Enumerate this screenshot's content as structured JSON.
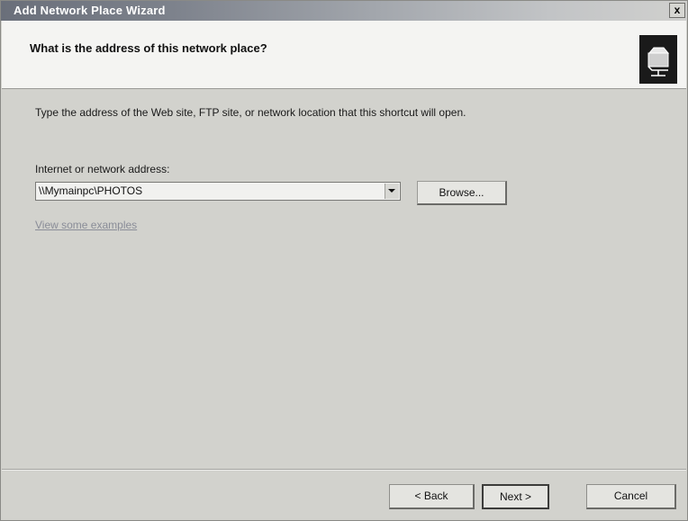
{
  "window": {
    "title": "Add Network Place Wizard",
    "close_label": "x"
  },
  "header": {
    "heading": "What is the address of this network place?",
    "icon": "network-folder-icon"
  },
  "content": {
    "instructions": "Type the address of the Web site, FTP site, or network location that this shortcut will open.",
    "address_label": "Internet or network address:",
    "address_value": "\\\\Mymainpc\\PHOTOS",
    "browse_label": "Browse...",
    "examples_link": "View some examples"
  },
  "footer": {
    "back_label": "< Back",
    "next_label": "Next >",
    "cancel_label": "Cancel"
  },
  "colors": {
    "dialog_background": "#d2d2cd",
    "header_background": "#f4f4f2",
    "link_color": "#8a8d98"
  }
}
